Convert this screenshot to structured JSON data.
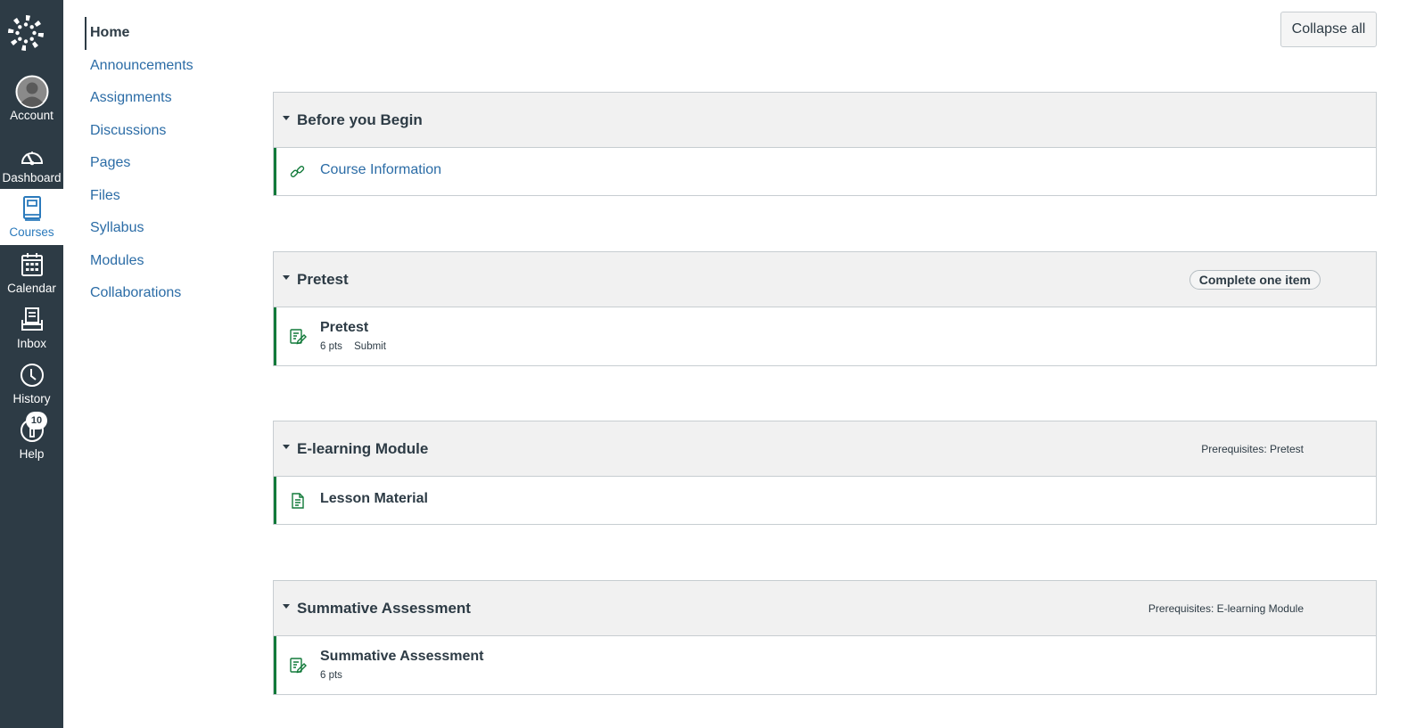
{
  "global_nav": {
    "items": [
      {
        "key": "account",
        "label": "Account",
        "icon": "avatar-icon"
      },
      {
        "key": "dashboard",
        "label": "Dashboard",
        "icon": "speedometer-icon"
      },
      {
        "key": "courses",
        "label": "Courses",
        "icon": "book-icon",
        "active": true
      },
      {
        "key": "calendar",
        "label": "Calendar",
        "icon": "calendar-icon"
      },
      {
        "key": "inbox",
        "label": "Inbox",
        "icon": "inbox-icon"
      },
      {
        "key": "history",
        "label": "History",
        "icon": "clock-icon"
      },
      {
        "key": "help",
        "label": "Help",
        "icon": "info-icon",
        "badge": "10"
      }
    ]
  },
  "course_nav": {
    "items": [
      {
        "label": "Home",
        "active": true
      },
      {
        "label": "Announcements"
      },
      {
        "label": "Assignments"
      },
      {
        "label": "Discussions"
      },
      {
        "label": "Pages"
      },
      {
        "label": "Files"
      },
      {
        "label": "Syllabus"
      },
      {
        "label": "Modules"
      },
      {
        "label": "Collaborations"
      }
    ]
  },
  "toolbar": {
    "collapse_all_label": "Collapse all"
  },
  "colors": {
    "nav_bg": "#2d3b45",
    "link": "#2b6ca6",
    "accent_green": "#127a3a",
    "module_header_bg": "#f1f1f1"
  },
  "modules": [
    {
      "title": "Before you Begin",
      "items": [
        {
          "title": "Course Information",
          "type": "link",
          "icon": "link-icon"
        }
      ]
    },
    {
      "title": "Pretest",
      "requirement": "Complete one item",
      "items": [
        {
          "title": "Pretest",
          "type": "quiz",
          "icon": "quiz-icon",
          "points": "6 pts",
          "action": "Submit"
        }
      ]
    },
    {
      "title": "E-learning Module",
      "prerequisites": "Prerequisites: Pretest",
      "items": [
        {
          "title": "Lesson Material",
          "type": "page",
          "icon": "page-icon"
        }
      ]
    },
    {
      "title": "Summative Assessment",
      "prerequisites": "Prerequisites: E-learning Module",
      "items": [
        {
          "title": "Summative Assessment",
          "type": "quiz",
          "icon": "quiz-icon",
          "points": "6 pts"
        }
      ]
    }
  ]
}
